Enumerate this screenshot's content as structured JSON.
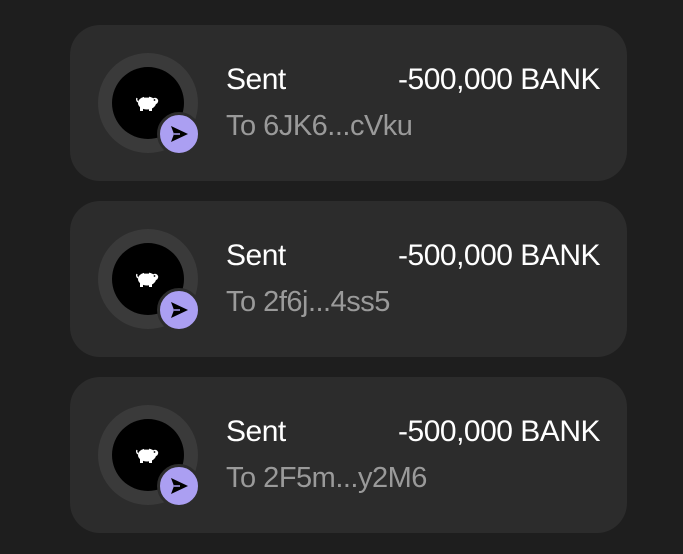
{
  "transactions": [
    {
      "title": "Sent",
      "amount": "-500,000 BANK",
      "subtitle": "To 6JK6...cVku",
      "token_icon": "piggy-bank-icon",
      "badge_icon": "send-arrow-icon"
    },
    {
      "title": "Sent",
      "amount": "-500,000 BANK",
      "subtitle": "To 2f6j...4ss5",
      "token_icon": "piggy-bank-icon",
      "badge_icon": "send-arrow-icon"
    },
    {
      "title": "Sent",
      "amount": "-500,000 BANK",
      "subtitle": "To 2F5m...y2M6",
      "token_icon": "piggy-bank-icon",
      "badge_icon": "send-arrow-icon"
    }
  ],
  "colors": {
    "background": "#1e1e1e",
    "card": "#2c2c2c",
    "badge_accent": "#ab9ff2",
    "primary_text": "#ffffff",
    "secondary_text": "#9a9a9a"
  }
}
